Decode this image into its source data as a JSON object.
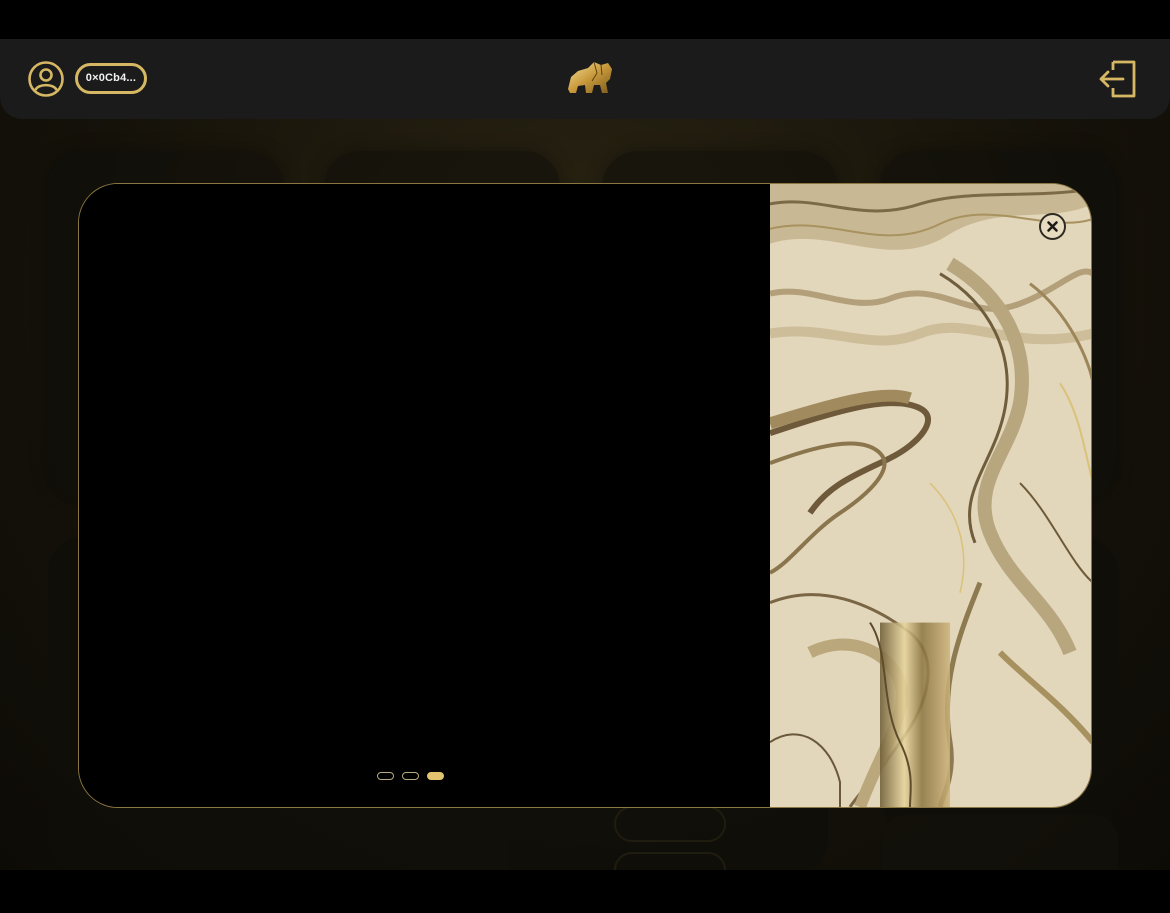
{
  "header": {
    "wallet_address": "0×0Cb4...",
    "profile_icon": "user-circle-icon",
    "logo_icon": "golden-elephant-logo",
    "logout_icon": "logout-icon"
  },
  "modal": {
    "slides_total": 3,
    "active_slide": 3,
    "close_icon": "close-icon",
    "accent_color": "#e3c46e"
  },
  "background": {
    "cards": [
      {
        "title": "",
        "badge": "",
        "value": "",
        "link": ""
      },
      {
        "title": "",
        "value": "",
        "link": ""
      },
      {
        "title": "",
        "value": "",
        "link": ""
      }
    ]
  },
  "colors": {
    "gold": "#d6b864",
    "header_bg": "#1b1b1b",
    "modal_border": "#8a7640"
  }
}
